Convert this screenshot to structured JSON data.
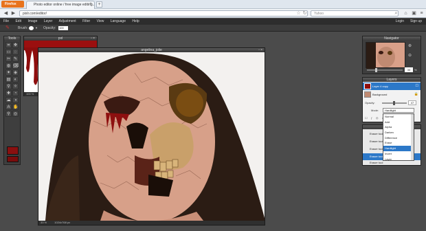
{
  "browser": {
    "app_button": "Firefox",
    "tab_title": "Photo editor online / free image editing...",
    "url": "pixlr.com/editor/",
    "search_placeholder": "Yahoo"
  },
  "menu": {
    "items": [
      "File",
      "Edit",
      "Image",
      "Layer",
      "Adjustment",
      "Filter",
      "View",
      "Language",
      "Help"
    ],
    "login": "Login",
    "signup": "Sign up"
  },
  "tool_options": {
    "brush_label": "Brush:",
    "opacity_label": "Opacity:",
    "opacity_value": "100"
  },
  "tools_panel": {
    "title": "Tools",
    "tools": [
      "⌗",
      "✥",
      "▭",
      "◌",
      "✂",
      "✎",
      "◍",
      "⌫",
      "✦",
      "◈",
      "▤",
      "◐",
      "⚲",
      "✧",
      "✚",
      "◔",
      "☁",
      "◑",
      "A",
      "✋",
      "⚲",
      "◎"
    ]
  },
  "blood_doc": {
    "title": "pxl",
    "zoom": "100 %"
  },
  "main_doc": {
    "title": "angelina_jolie",
    "zoom": "33 %",
    "dims": "1024x768 px"
  },
  "navigator": {
    "title": "Navigator",
    "zoom": "33",
    "percent": "%"
  },
  "layers": {
    "title": "Layers",
    "rows": [
      "Layer 4 copy",
      "Background"
    ],
    "opacity_label": "Opacity:",
    "opacity_value": "47",
    "mode_label": "Mode:",
    "mode_value": "Hardlight"
  },
  "blend_modes": [
    "Normal",
    "Add",
    "Alpha",
    "Darken",
    "Difference",
    "Erase",
    "Hardlight",
    "Invert",
    "Layer"
  ],
  "history": {
    "title": "History",
    "items": [
      "Eraser tool",
      "Eraser tool",
      "Eraser tool",
      "Eraser tool",
      "Eraser tool"
    ]
  },
  "colors": {
    "foreground": "#8a1010",
    "background": "#7a0c0c",
    "accent": "#2c78c8"
  }
}
